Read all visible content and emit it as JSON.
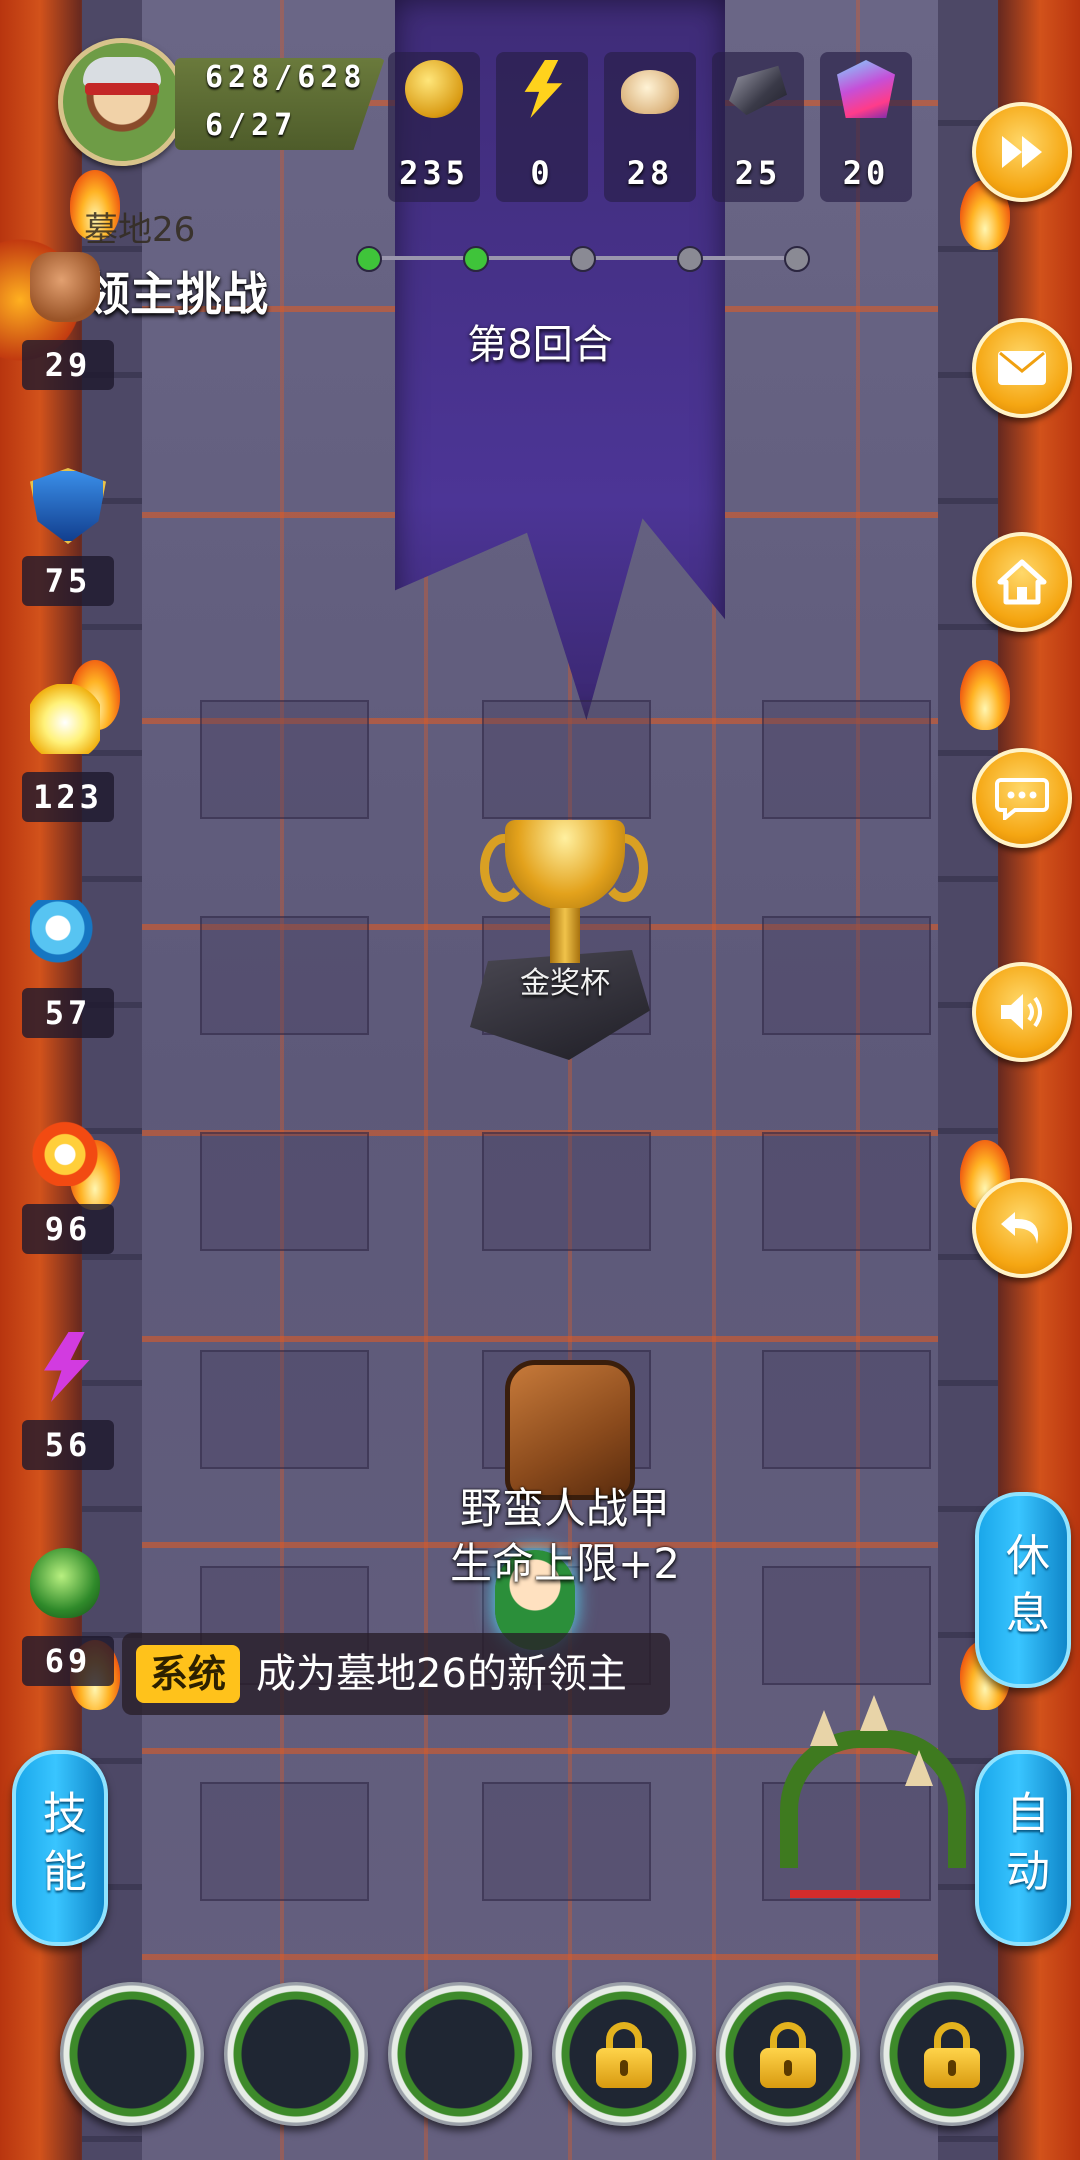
{
  "hud": {
    "hp": "628/628",
    "moves": "6/27",
    "resources": [
      {
        "icon": "gold-coin-icon",
        "value": "235"
      },
      {
        "icon": "lightning-icon",
        "value": "0"
      },
      {
        "icon": "bun-icon",
        "value": "28"
      },
      {
        "icon": "iron-ingot-icon",
        "value": "25"
      },
      {
        "icon": "crystal-gem-icon",
        "value": "20"
      }
    ]
  },
  "level": {
    "name": "墓地26",
    "challenge_title": "领主挑战",
    "round_label": "第8回合",
    "progress_done": 2,
    "progress_total": 5
  },
  "side_stats": [
    {
      "icon": "fist-icon",
      "value": "29"
    },
    {
      "icon": "shield-icon",
      "value": "75"
    },
    {
      "icon": "holy-light-icon",
      "value": "123"
    },
    {
      "icon": "water-wave-icon",
      "value": "57"
    },
    {
      "icon": "fire-icon",
      "value": "96"
    },
    {
      "icon": "lightning-magic-icon",
      "value": "56"
    },
    {
      "icon": "poison-icon",
      "value": "69"
    }
  ],
  "items": {
    "trophy_label": "金奖杯",
    "armor_name": "野蛮人战甲",
    "armor_effect": "生命上限+2"
  },
  "chat": {
    "tag": "系统",
    "message": "成为墓地26的新领主"
  },
  "right_buttons": [
    "fast-forward-icon",
    "mail-icon",
    "home-icon",
    "chat-bubble-icon",
    "speaker-icon",
    "back-arrow-icon"
  ],
  "actions": {
    "rest": "休息",
    "auto": "自动",
    "skills": "技能"
  },
  "skill_slots": [
    {
      "locked": false
    },
    {
      "locked": false
    },
    {
      "locked": false
    },
    {
      "locked": true
    },
    {
      "locked": true
    },
    {
      "locked": true
    }
  ],
  "colors": {
    "accent_orange": "#f5a612",
    "action_blue": "#1aa7ea",
    "system_tag": "#ffc21b",
    "progress_done": "#3fc43a",
    "progress_todo": "#8a8a94"
  }
}
